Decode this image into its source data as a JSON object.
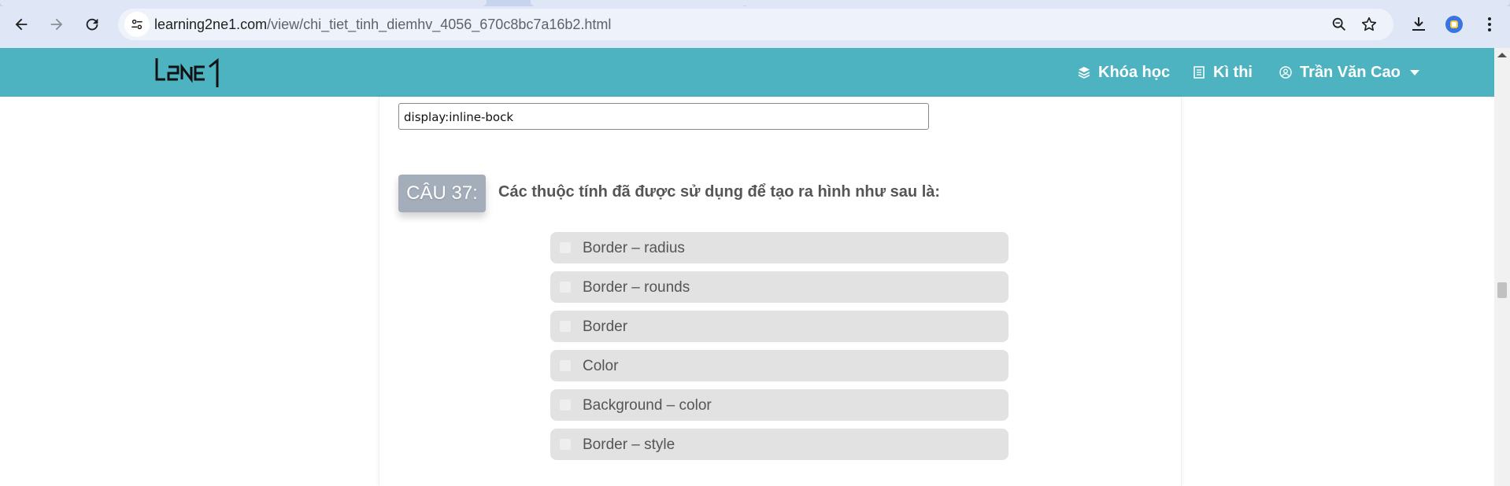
{
  "browser": {
    "url_host": "learning2ne1.com",
    "url_path": "/view/chi_tiet_tinh_diemhv_4056_670c8bc7a16b2.html",
    "icons": [
      "back-arrow-icon",
      "forward-arrow-icon",
      "reload-icon",
      "site-info-icon",
      "zoom-icon",
      "star-icon",
      "download-icon",
      "profile-icon",
      "menu-icon"
    ]
  },
  "site": {
    "logo_text": "L2NE1",
    "nav": [
      {
        "label": "Khóa học",
        "icon": "layers-icon"
      },
      {
        "label": "Kì thi",
        "icon": "list-icon"
      },
      {
        "label": "Trần Văn Cao",
        "icon": "user-circle-icon"
      }
    ]
  },
  "previous_answer": {
    "value": "display:inline-bock"
  },
  "question": {
    "badge": "CÂU 37:",
    "text": "Các thuộc tính đã được sử dụng để tạo ra hình như sau là:",
    "options": [
      {
        "label": "Border – radius",
        "checked": false
      },
      {
        "label": "Border – rounds",
        "checked": false
      },
      {
        "label": "Border",
        "checked": false
      },
      {
        "label": "Color",
        "checked": false
      },
      {
        "label": "Background – color",
        "checked": false
      },
      {
        "label": "Border – style",
        "checked": false
      }
    ]
  },
  "colors": {
    "header_bg": "#4db3c1",
    "badge_bg": "#a4adba",
    "option_bg": "#e2e2e2",
    "chrome_bg": "#dfe7f7"
  }
}
